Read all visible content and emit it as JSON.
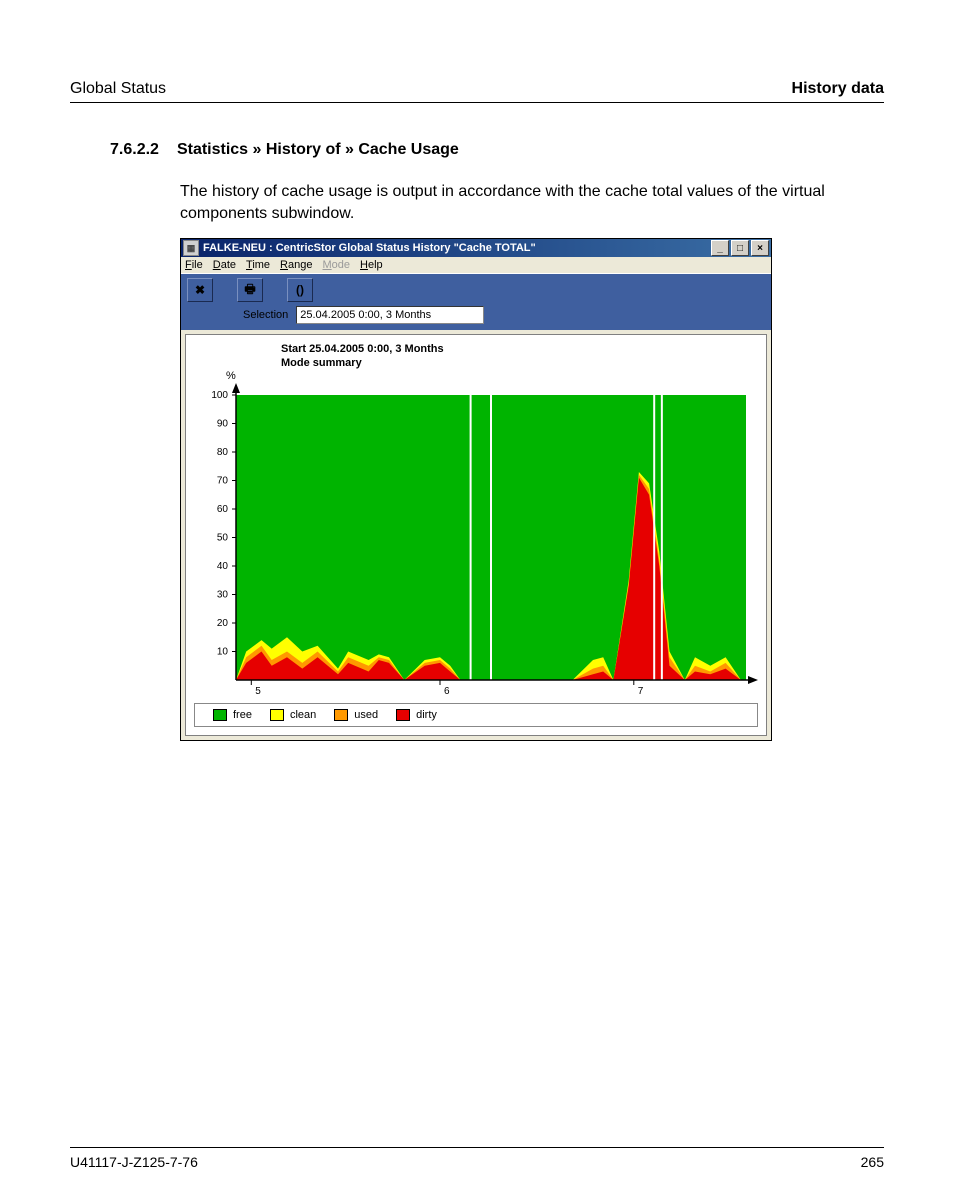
{
  "header": {
    "left": "Global Status",
    "right": "History data"
  },
  "section": {
    "num": "7.6.2.2",
    "title": "Statistics » History of » Cache Usage"
  },
  "paragraph": "The history of cache usage is output in accordance with the cache total values of the virtual components subwindow.",
  "window": {
    "title": "FALKE-NEU : CentricStor Global Status History \"Cache TOTAL\"",
    "menu": [
      "File",
      "Date",
      "Time",
      "Range",
      "Mode",
      "Help"
    ],
    "menu_disabled_index": 4,
    "selection_label": "Selection",
    "selection_value": "25.04.2005 0:00, 3 Months",
    "chart_info_start": "Start  25.04.2005 0:00, 3 Months",
    "chart_info_mode": "Mode  summary",
    "ylabel": "%",
    "legend": [
      {
        "name": "free",
        "color": "#00b400"
      },
      {
        "name": "clean",
        "color": "#ffff00"
      },
      {
        "name": "used",
        "color": "#ff9900"
      },
      {
        "name": "dirty",
        "color": "#e60000"
      }
    ]
  },
  "chart_data": {
    "type": "area",
    "title": "Cache TOTAL history",
    "ylabel": "%",
    "ylim": [
      0,
      100
    ],
    "yticks": [
      10,
      20,
      30,
      40,
      50,
      60,
      70,
      80,
      90,
      100
    ],
    "x_categories": [
      "5",
      "6",
      "7"
    ],
    "series": [
      {
        "name": "free",
        "color": "#00b400"
      },
      {
        "name": "clean",
        "color": "#ffff00"
      },
      {
        "name": "used",
        "color": "#ff9900"
      },
      {
        "name": "dirty",
        "color": "#e60000"
      }
    ],
    "samples": [
      {
        "x": 0.0,
        "dirty": 0,
        "used": 0,
        "clean": 0
      },
      {
        "x": 0.02,
        "dirty": 6,
        "used": 8,
        "clean": 10
      },
      {
        "x": 0.05,
        "dirty": 10,
        "used": 12,
        "clean": 14
      },
      {
        "x": 0.07,
        "dirty": 5,
        "used": 7,
        "clean": 11
      },
      {
        "x": 0.1,
        "dirty": 8,
        "used": 10,
        "clean": 15
      },
      {
        "x": 0.13,
        "dirty": 4,
        "used": 6,
        "clean": 10
      },
      {
        "x": 0.16,
        "dirty": 8,
        "used": 10,
        "clean": 12
      },
      {
        "x": 0.2,
        "dirty": 2,
        "used": 3,
        "clean": 4
      },
      {
        "x": 0.22,
        "dirty": 6,
        "used": 8,
        "clean": 10
      },
      {
        "x": 0.26,
        "dirty": 3,
        "used": 5,
        "clean": 7
      },
      {
        "x": 0.28,
        "dirty": 7,
        "used": 8,
        "clean": 9
      },
      {
        "x": 0.3,
        "dirty": 6,
        "used": 7,
        "clean": 8
      },
      {
        "x": 0.33,
        "dirty": 0,
        "used": 0,
        "clean": 0
      },
      {
        "x": 0.37,
        "dirty": 5,
        "used": 6,
        "clean": 7
      },
      {
        "x": 0.4,
        "dirty": 6,
        "used": 7,
        "clean": 8
      },
      {
        "x": 0.42,
        "dirty": 3,
        "used": 4,
        "clean": 5
      },
      {
        "x": 0.44,
        "dirty": 0,
        "used": 0,
        "clean": 0
      },
      {
        "x": 0.48,
        "dirty": 0,
        "used": 0,
        "clean": 0
      },
      {
        "x": 0.55,
        "dirty": 0,
        "used": 0,
        "clean": 0
      },
      {
        "x": 0.6,
        "dirty": 0,
        "used": 0,
        "clean": 0
      },
      {
        "x": 0.66,
        "dirty": 0,
        "used": 0,
        "clean": 0
      },
      {
        "x": 0.7,
        "dirty": 2,
        "used": 4,
        "clean": 7
      },
      {
        "x": 0.72,
        "dirty": 3,
        "used": 5,
        "clean": 8
      },
      {
        "x": 0.74,
        "dirty": 0,
        "used": 0,
        "clean": 0
      },
      {
        "x": 0.77,
        "dirty": 33,
        "used": 34,
        "clean": 35
      },
      {
        "x": 0.79,
        "dirty": 71,
        "used": 72,
        "clean": 73
      },
      {
        "x": 0.81,
        "dirty": 65,
        "used": 67,
        "clean": 69
      },
      {
        "x": 0.83,
        "dirty": 40,
        "used": 42,
        "clean": 45
      },
      {
        "x": 0.85,
        "dirty": 5,
        "used": 8,
        "clean": 10
      },
      {
        "x": 0.88,
        "dirty": 0,
        "used": 0,
        "clean": 0
      },
      {
        "x": 0.9,
        "dirty": 3,
        "used": 5,
        "clean": 8
      },
      {
        "x": 0.93,
        "dirty": 2,
        "used": 3,
        "clean": 5
      },
      {
        "x": 0.96,
        "dirty": 4,
        "used": 6,
        "clean": 8
      },
      {
        "x": 0.99,
        "dirty": 0,
        "used": 0,
        "clean": 0
      }
    ],
    "gaps": [
      0.46,
      0.5,
      0.82,
      0.835
    ]
  },
  "footer": {
    "left": "U41117-J-Z125-7-76",
    "right": "265"
  }
}
